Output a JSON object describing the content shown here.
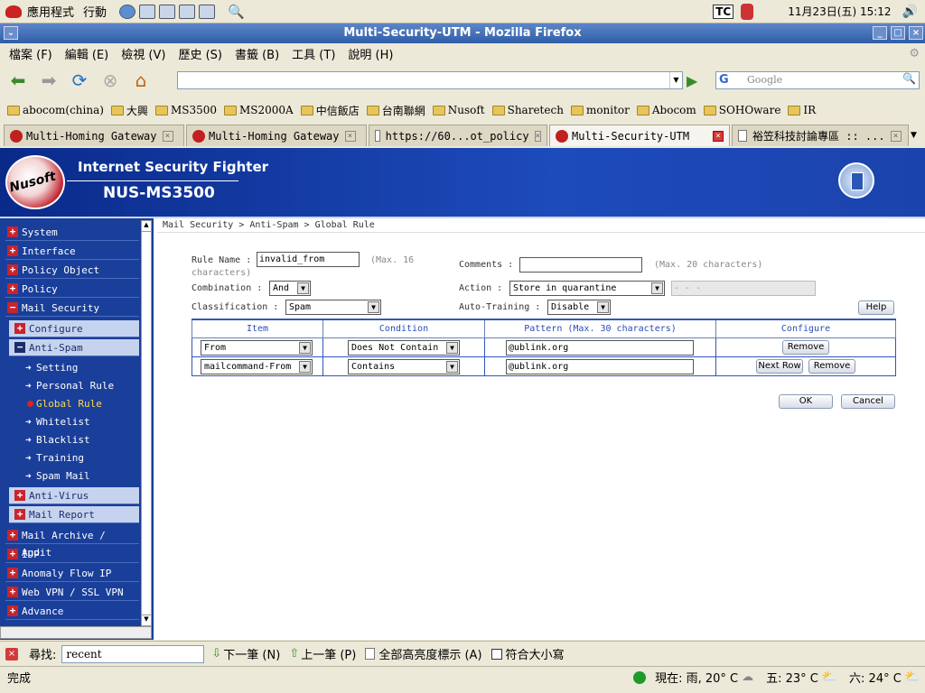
{
  "topbar": {
    "menu1": "應用程式",
    "menu2": "行動",
    "kbd": "TC",
    "clock": "11月23日(五) 15:12"
  },
  "window": {
    "title": "Multi-Security-UTM - Mozilla Firefox"
  },
  "menubar": [
    "檔案 (F)",
    "編輯 (E)",
    "檢視 (V)",
    "歷史 (S)",
    "書籤 (B)",
    "工具 (T)",
    "說明 (H)"
  ],
  "search_placeholder": "Google",
  "bookmarks": [
    "abocom(china)",
    "大興",
    "MS3500",
    "MS2000A",
    "中信飯店",
    "台南聯網",
    "Nusoft",
    "Sharetech",
    "monitor",
    "Abocom",
    "SOHOware",
    "IR"
  ],
  "tabs": [
    "Multi-Homing Gateway",
    "Multi-Homing Gateway",
    "https://60...ot_policy",
    "Multi-Security-UTM",
    "裕笠科技討論專區 :: ..."
  ],
  "header": {
    "logo_text": "Nusoft",
    "tagline": "Internet Security Fighter",
    "model": "NUS-MS3500"
  },
  "sidebar": {
    "system": "System",
    "interface": "Interface",
    "policy_object": "Policy Object",
    "policy": "Policy",
    "mail_security": "Mail Security",
    "configure": "Configure",
    "anti_spam": "Anti-Spam",
    "setting": "Setting",
    "personal_rule": "Personal Rule",
    "global_rule": "Global Rule",
    "whitelist": "Whitelist",
    "blacklist": "Blacklist",
    "training": "Training",
    "spam_mail": "Spam Mail",
    "anti_virus": "Anti-Virus",
    "mail_report": "Mail Report",
    "mail_archive": "Mail Archive / Audit",
    "idp": "IDP",
    "anomaly_flow": "Anomaly Flow IP",
    "web_vpn": "Web VPN / SSL VPN",
    "advance": "Advance"
  },
  "breadcrumb": "Mail Security > Anti-Spam > Global Rule",
  "form": {
    "rule_name_label": "Rule Name :",
    "rule_name_value": "invalid_from",
    "rule_name_hint": "(Max. 16",
    "rule_name_hint2": "characters)",
    "comments_label": "Comments :",
    "comments_value": "",
    "comments_hint": "(Max. 20 characters)",
    "combination_label": "Combination :",
    "combination_value": "And",
    "action_label": "Action :",
    "action_value": "Store in quarantine",
    "action_extra": "- - -",
    "classification_label": "Classification :",
    "classification_value": "Spam",
    "auto_training_label": "Auto-Training :",
    "auto_training_value": "Disable",
    "help_btn": "Help"
  },
  "table": {
    "headers": [
      "Item",
      "Condition",
      "Pattern (Max. 30 characters)",
      "Configure"
    ],
    "rows": [
      {
        "item": "From",
        "condition": "Does Not Contain",
        "pattern": "@ublink.org",
        "btn1": "Remove",
        "btn2": ""
      },
      {
        "item": "mailcommand-From",
        "condition": "Contains",
        "pattern": "@ublink.org",
        "btn1": "Next Row",
        "btn2": "Remove"
      }
    ]
  },
  "ok_btn": "OK",
  "cancel_btn": "Cancel",
  "findbar": {
    "label": "尋找:",
    "value": "recent",
    "next": "下一筆 (N)",
    "prev": "上一筆 (P)",
    "highlight": "全部高亮度標示 (A)",
    "matchcase": "符合大小寫"
  },
  "statusbar": {
    "text": "完成",
    "weather_now": "現在: 雨, 20° C",
    "weather_fri": "五: 23° C",
    "weather_sat": "六: 24° C"
  }
}
